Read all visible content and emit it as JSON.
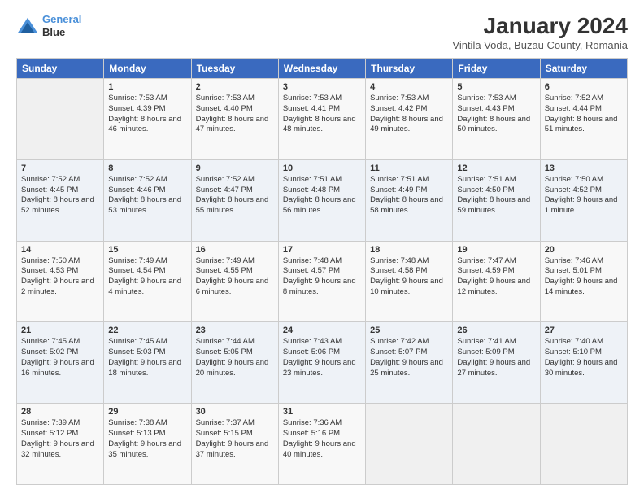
{
  "logo": {
    "line1": "General",
    "line2": "Blue"
  },
  "title": "January 2024",
  "subtitle": "Vintila Voda, Buzau County, Romania",
  "days": [
    "Sunday",
    "Monday",
    "Tuesday",
    "Wednesday",
    "Thursday",
    "Friday",
    "Saturday"
  ],
  "weeks": [
    [
      {
        "num": "",
        "sunrise": "",
        "sunset": "",
        "daylight": ""
      },
      {
        "num": "1",
        "sunrise": "Sunrise: 7:53 AM",
        "sunset": "Sunset: 4:39 PM",
        "daylight": "Daylight: 8 hours and 46 minutes."
      },
      {
        "num": "2",
        "sunrise": "Sunrise: 7:53 AM",
        "sunset": "Sunset: 4:40 PM",
        "daylight": "Daylight: 8 hours and 47 minutes."
      },
      {
        "num": "3",
        "sunrise": "Sunrise: 7:53 AM",
        "sunset": "Sunset: 4:41 PM",
        "daylight": "Daylight: 8 hours and 48 minutes."
      },
      {
        "num": "4",
        "sunrise": "Sunrise: 7:53 AM",
        "sunset": "Sunset: 4:42 PM",
        "daylight": "Daylight: 8 hours and 49 minutes."
      },
      {
        "num": "5",
        "sunrise": "Sunrise: 7:53 AM",
        "sunset": "Sunset: 4:43 PM",
        "daylight": "Daylight: 8 hours and 50 minutes."
      },
      {
        "num": "6",
        "sunrise": "Sunrise: 7:52 AM",
        "sunset": "Sunset: 4:44 PM",
        "daylight": "Daylight: 8 hours and 51 minutes."
      }
    ],
    [
      {
        "num": "7",
        "sunrise": "Sunrise: 7:52 AM",
        "sunset": "Sunset: 4:45 PM",
        "daylight": "Daylight: 8 hours and 52 minutes."
      },
      {
        "num": "8",
        "sunrise": "Sunrise: 7:52 AM",
        "sunset": "Sunset: 4:46 PM",
        "daylight": "Daylight: 8 hours and 53 minutes."
      },
      {
        "num": "9",
        "sunrise": "Sunrise: 7:52 AM",
        "sunset": "Sunset: 4:47 PM",
        "daylight": "Daylight: 8 hours and 55 minutes."
      },
      {
        "num": "10",
        "sunrise": "Sunrise: 7:51 AM",
        "sunset": "Sunset: 4:48 PM",
        "daylight": "Daylight: 8 hours and 56 minutes."
      },
      {
        "num": "11",
        "sunrise": "Sunrise: 7:51 AM",
        "sunset": "Sunset: 4:49 PM",
        "daylight": "Daylight: 8 hours and 58 minutes."
      },
      {
        "num": "12",
        "sunrise": "Sunrise: 7:51 AM",
        "sunset": "Sunset: 4:50 PM",
        "daylight": "Daylight: 8 hours and 59 minutes."
      },
      {
        "num": "13",
        "sunrise": "Sunrise: 7:50 AM",
        "sunset": "Sunset: 4:52 PM",
        "daylight": "Daylight: 9 hours and 1 minute."
      }
    ],
    [
      {
        "num": "14",
        "sunrise": "Sunrise: 7:50 AM",
        "sunset": "Sunset: 4:53 PM",
        "daylight": "Daylight: 9 hours and 2 minutes."
      },
      {
        "num": "15",
        "sunrise": "Sunrise: 7:49 AM",
        "sunset": "Sunset: 4:54 PM",
        "daylight": "Daylight: 9 hours and 4 minutes."
      },
      {
        "num": "16",
        "sunrise": "Sunrise: 7:49 AM",
        "sunset": "Sunset: 4:55 PM",
        "daylight": "Daylight: 9 hours and 6 minutes."
      },
      {
        "num": "17",
        "sunrise": "Sunrise: 7:48 AM",
        "sunset": "Sunset: 4:57 PM",
        "daylight": "Daylight: 9 hours and 8 minutes."
      },
      {
        "num": "18",
        "sunrise": "Sunrise: 7:48 AM",
        "sunset": "Sunset: 4:58 PM",
        "daylight": "Daylight: 9 hours and 10 minutes."
      },
      {
        "num": "19",
        "sunrise": "Sunrise: 7:47 AM",
        "sunset": "Sunset: 4:59 PM",
        "daylight": "Daylight: 9 hours and 12 minutes."
      },
      {
        "num": "20",
        "sunrise": "Sunrise: 7:46 AM",
        "sunset": "Sunset: 5:01 PM",
        "daylight": "Daylight: 9 hours and 14 minutes."
      }
    ],
    [
      {
        "num": "21",
        "sunrise": "Sunrise: 7:45 AM",
        "sunset": "Sunset: 5:02 PM",
        "daylight": "Daylight: 9 hours and 16 minutes."
      },
      {
        "num": "22",
        "sunrise": "Sunrise: 7:45 AM",
        "sunset": "Sunset: 5:03 PM",
        "daylight": "Daylight: 9 hours and 18 minutes."
      },
      {
        "num": "23",
        "sunrise": "Sunrise: 7:44 AM",
        "sunset": "Sunset: 5:05 PM",
        "daylight": "Daylight: 9 hours and 20 minutes."
      },
      {
        "num": "24",
        "sunrise": "Sunrise: 7:43 AM",
        "sunset": "Sunset: 5:06 PM",
        "daylight": "Daylight: 9 hours and 23 minutes."
      },
      {
        "num": "25",
        "sunrise": "Sunrise: 7:42 AM",
        "sunset": "Sunset: 5:07 PM",
        "daylight": "Daylight: 9 hours and 25 minutes."
      },
      {
        "num": "26",
        "sunrise": "Sunrise: 7:41 AM",
        "sunset": "Sunset: 5:09 PM",
        "daylight": "Daylight: 9 hours and 27 minutes."
      },
      {
        "num": "27",
        "sunrise": "Sunrise: 7:40 AM",
        "sunset": "Sunset: 5:10 PM",
        "daylight": "Daylight: 9 hours and 30 minutes."
      }
    ],
    [
      {
        "num": "28",
        "sunrise": "Sunrise: 7:39 AM",
        "sunset": "Sunset: 5:12 PM",
        "daylight": "Daylight: 9 hours and 32 minutes."
      },
      {
        "num": "29",
        "sunrise": "Sunrise: 7:38 AM",
        "sunset": "Sunset: 5:13 PM",
        "daylight": "Daylight: 9 hours and 35 minutes."
      },
      {
        "num": "30",
        "sunrise": "Sunrise: 7:37 AM",
        "sunset": "Sunset: 5:15 PM",
        "daylight": "Daylight: 9 hours and 37 minutes."
      },
      {
        "num": "31",
        "sunrise": "Sunrise: 7:36 AM",
        "sunset": "Sunset: 5:16 PM",
        "daylight": "Daylight: 9 hours and 40 minutes."
      },
      {
        "num": "",
        "sunrise": "",
        "sunset": "",
        "daylight": ""
      },
      {
        "num": "",
        "sunrise": "",
        "sunset": "",
        "daylight": ""
      },
      {
        "num": "",
        "sunrise": "",
        "sunset": "",
        "daylight": ""
      }
    ]
  ]
}
